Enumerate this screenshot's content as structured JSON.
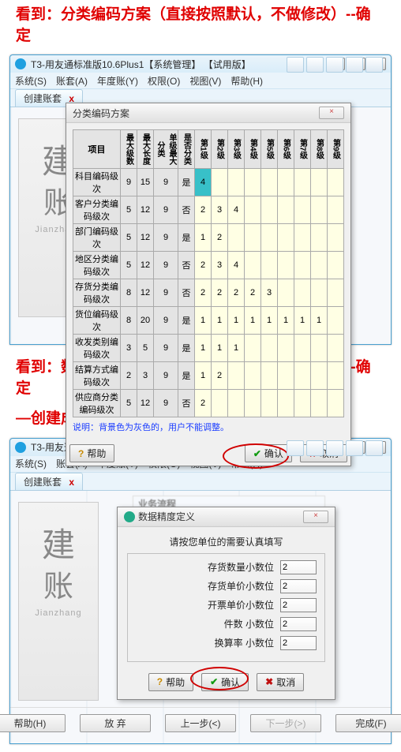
{
  "instr1": "看到：分类编码方案（直接按照默认，不做修改）--确定",
  "instr2": "看到：数据精确定义（直接按照默认，不做修改）--确定",
  "instr3": "—创建成功",
  "win": {
    "title": "T3-用友通标准版10.6Plus1【系统管理】 【试用版】",
    "minimize": "—",
    "maximize": "□",
    "close": "×"
  },
  "menu": [
    "系统(S)",
    "账套(A)",
    "年度账(Y)",
    "权限(O)",
    "视图(V)",
    "帮助(H)"
  ],
  "tab": {
    "label": "创建账套",
    "close": "x"
  },
  "left_art": {
    "han1": "建",
    "han2": "账",
    "pinyin": "Jianzhang"
  },
  "dlg1": {
    "title": "分类编码方案",
    "headers": {
      "project": "项目",
      "maxLevels": "最大级数",
      "maxLen": "最大长度",
      "singleMax": "单级最大分类",
      "isFirst": "是否分类",
      "lv": [
        "第1级",
        "第2级",
        "第3级",
        "第4级",
        "第5级",
        "第6级",
        "第7级",
        "第8级",
        "第9级"
      ]
    },
    "rows": [
      {
        "name": "科目编码级次",
        "a": "9",
        "b": "15",
        "c": "9",
        "d": "是",
        "g": [
          "4",
          "",
          "",
          "",
          "",
          "",
          "",
          "",
          ""
        ]
      },
      {
        "name": "客户分类编码级次",
        "a": "5",
        "b": "12",
        "c": "9",
        "d": "否",
        "g": [
          "2",
          "3",
          "4",
          "",
          "",
          "",
          "",
          "",
          ""
        ]
      },
      {
        "name": "部门编码级次",
        "a": "5",
        "b": "12",
        "c": "9",
        "d": "是",
        "g": [
          "1",
          "2",
          "",
          "",
          "",
          "",
          "",
          "",
          ""
        ]
      },
      {
        "name": "地区分类编码级次",
        "a": "5",
        "b": "12",
        "c": "9",
        "d": "否",
        "g": [
          "2",
          "3",
          "4",
          "",
          "",
          "",
          "",
          "",
          ""
        ]
      },
      {
        "name": "存货分类编码级次",
        "a": "8",
        "b": "12",
        "c": "9",
        "d": "否",
        "g": [
          "2",
          "2",
          "2",
          "2",
          "3",
          "",
          "",
          "",
          ""
        ]
      },
      {
        "name": "货位编码级次",
        "a": "8",
        "b": "20",
        "c": "9",
        "d": "是",
        "g": [
          "1",
          "1",
          "1",
          "1",
          "1",
          "1",
          "1",
          "1",
          ""
        ]
      },
      {
        "name": "收发类别编码级次",
        "a": "3",
        "b": "5",
        "c": "9",
        "d": "是",
        "g": [
          "1",
          "1",
          "1",
          "",
          "",
          "",
          "",
          "",
          ""
        ]
      },
      {
        "name": "结算方式编码级次",
        "a": "2",
        "b": "3",
        "c": "9",
        "d": "是",
        "g": [
          "1",
          "2",
          "",
          "",
          "",
          "",
          "",
          "",
          ""
        ]
      },
      {
        "name": "供应商分类编码级次",
        "a": "5",
        "b": "12",
        "c": "9",
        "d": "否",
        "g": [
          "2",
          "",
          "",
          "",
          "",
          "",
          "",
          "",
          ""
        ]
      }
    ],
    "note": "说明：背景色为灰色的，用户不能调整。",
    "help": "帮助",
    "ok": "确认",
    "cancel": "取消"
  },
  "dlg2": {
    "title": "数据精度定义",
    "instr": "请按您单位的需要认真填写",
    "fields": [
      {
        "label": "存货数量小数位",
        "val": "2"
      },
      {
        "label": "存货单价小数位",
        "val": "2"
      },
      {
        "label": "开票单价小数位",
        "val": "2"
      },
      {
        "label": "件数   小数位",
        "val": "2"
      },
      {
        "label": "换算率 小数位",
        "val": "2"
      }
    ],
    "help": "帮助",
    "ok": "确认",
    "cancel": "取消"
  },
  "blur_title": "业务流程",
  "wizard": {
    "help": "帮助(H)",
    "discard": "放 弃",
    "prev": "上一步(<)",
    "next": "下一步(>)",
    "finish": "完成(F)"
  }
}
